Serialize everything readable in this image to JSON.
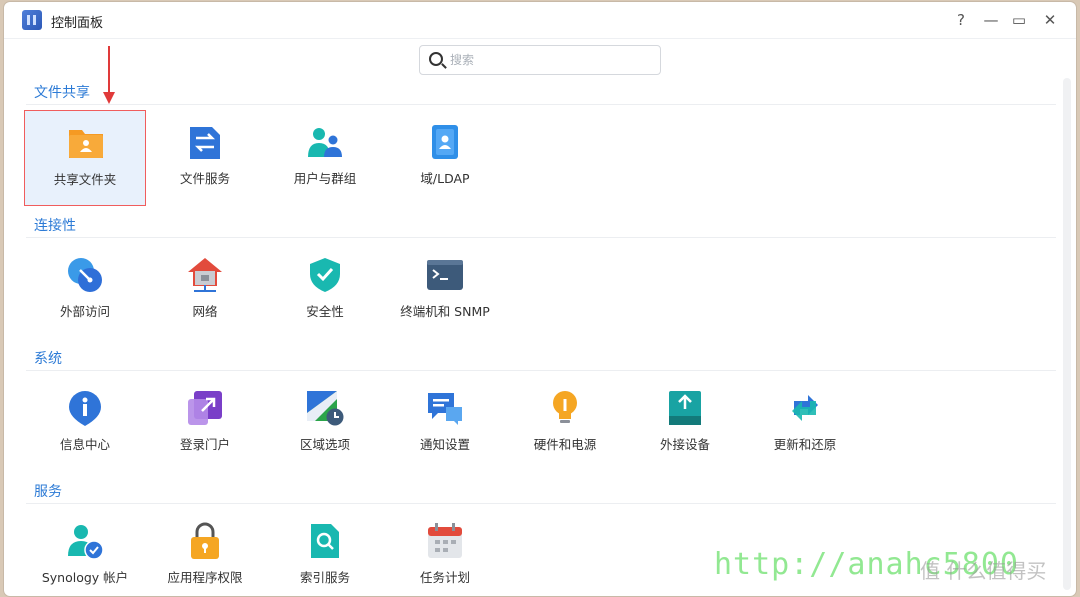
{
  "window": {
    "title": "控制面板"
  },
  "controls": {
    "help": "?",
    "minimize": "—",
    "maximize": "▭",
    "close": "✕"
  },
  "search": {
    "placeholder": "搜索",
    "value": ""
  },
  "sections": [
    {
      "title": "文件共享",
      "items": [
        {
          "label": "共享文件夹",
          "icon": "shared-folder-icon",
          "selected": true
        },
        {
          "label": "文件服务",
          "icon": "file-services-icon"
        },
        {
          "label": "用户与群组",
          "icon": "user-group-icon"
        },
        {
          "label": "域/LDAP",
          "icon": "domain-ldap-icon"
        }
      ]
    },
    {
      "title": "连接性",
      "items": [
        {
          "label": "外部访问",
          "icon": "external-access-icon"
        },
        {
          "label": "网络",
          "icon": "network-icon"
        },
        {
          "label": "安全性",
          "icon": "security-icon"
        },
        {
          "label": "终端机和 SNMP",
          "icon": "terminal-snmp-icon"
        }
      ]
    },
    {
      "title": "系统",
      "items": [
        {
          "label": "信息中心",
          "icon": "info-center-icon"
        },
        {
          "label": "登录门户",
          "icon": "login-portal-icon"
        },
        {
          "label": "区域选项",
          "icon": "regional-options-icon"
        },
        {
          "label": "通知设置",
          "icon": "notification-icon"
        },
        {
          "label": "硬件和电源",
          "icon": "hardware-power-icon"
        },
        {
          "label": "外接设备",
          "icon": "external-devices-icon"
        },
        {
          "label": "更新和还原",
          "icon": "update-restore-icon"
        }
      ]
    },
    {
      "title": "服务",
      "items": [
        {
          "label": "Synology 帐户",
          "icon": "synology-account-icon"
        },
        {
          "label": "应用程序权限",
          "icon": "app-privileges-icon"
        },
        {
          "label": "索引服务",
          "icon": "indexing-service-icon"
        },
        {
          "label": "任务计划",
          "icon": "task-scheduler-icon"
        }
      ]
    }
  ],
  "watermark": {
    "text": "http://anahc5800",
    "brand": "值 什么值得买"
  },
  "colors": {
    "accent": "#2d7bd6",
    "selection_border": "#f05d5d",
    "arrow": "#e03a3a"
  }
}
